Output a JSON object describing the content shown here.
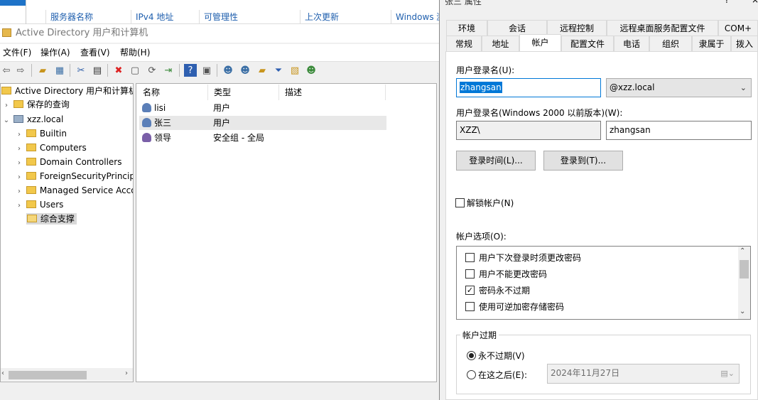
{
  "bg_window": {
    "columns": [
      "服务器名称",
      "IPv4 地址",
      "可管理性",
      "上次更新",
      "Windows 激"
    ]
  },
  "aduc": {
    "title": "Active Directory 用户和计算机",
    "menu": [
      "文件(F)",
      "操作(A)",
      "查看(V)",
      "帮助(H)"
    ],
    "tree": [
      {
        "label": "Active Directory 用户和计算机",
        "level": 0,
        "arrow": "",
        "icon": "folder-icon"
      },
      {
        "label": "保存的查询",
        "level": 1,
        "arrow": "›",
        "icon": "folder-icon"
      },
      {
        "label": "xzz.local",
        "level": 1,
        "arrow": "⌄",
        "icon": "domain-icon"
      },
      {
        "label": "Builtin",
        "level": 2,
        "arrow": "›",
        "icon": "folder-icon"
      },
      {
        "label": "Computers",
        "level": 2,
        "arrow": "›",
        "icon": "folder-icon"
      },
      {
        "label": "Domain Controllers",
        "level": 2,
        "arrow": "›",
        "icon": "folder-icon"
      },
      {
        "label": "ForeignSecurityPrincipals",
        "level": 2,
        "arrow": "›",
        "icon": "folder-icon"
      },
      {
        "label": "Managed Service Accounts",
        "level": 2,
        "arrow": "›",
        "icon": "folder-icon"
      },
      {
        "label": "Users",
        "level": 2,
        "arrow": "›",
        "icon": "folder-icon"
      },
      {
        "label": "综合支撑",
        "level": 2,
        "arrow": "",
        "icon": "ou-icon"
      }
    ],
    "list": {
      "headers": [
        "名称",
        "类型",
        "描述"
      ],
      "rows": [
        {
          "name": "lisi",
          "type": "用户",
          "icon": "user-icon"
        },
        {
          "name": "张三",
          "type": "用户",
          "icon": "user-icon"
        },
        {
          "name": "领导",
          "type": "安全组 - 全局",
          "icon": "group-icon"
        }
      ]
    }
  },
  "dialog": {
    "title": "张三 属性",
    "help": "?",
    "close": "×",
    "tabs_row1": [
      "环境",
      "会话",
      "远程控制",
      "远程桌面服务配置文件",
      "COM+"
    ],
    "tabs_row2": [
      "常规",
      "地址",
      "帐户",
      "配置文件",
      "电话",
      "组织",
      "隶属于",
      "拨入"
    ],
    "active_tab": "帐户",
    "logon_name_label": "用户登录名(U):",
    "logon_name": "zhangsan",
    "upn_suffix": "@xzz.local",
    "pre2000_label": "用户登录名(Windows 2000 以前版本)(W):",
    "pre2000_domain": "XZZ\\",
    "pre2000_name": "zhangsan",
    "logon_hours_button": "登录时间(L)...",
    "logon_to_button": "登录到(T)...",
    "unlock_label": "解锁帐户(N)",
    "options_label": "帐户选项(O):",
    "options": [
      {
        "label": "用户下次登录时须更改密码",
        "checked": false
      },
      {
        "label": "用户不能更改密码",
        "checked": false
      },
      {
        "label": "密码永不过期",
        "checked": true
      },
      {
        "label": "使用可逆加密存储密码",
        "checked": false
      }
    ],
    "expiry_group_label": "帐户过期",
    "never_expires_label": "永不过期(V)",
    "end_of_label": "在这之后(E):",
    "end_date": "2024年11月27日"
  }
}
